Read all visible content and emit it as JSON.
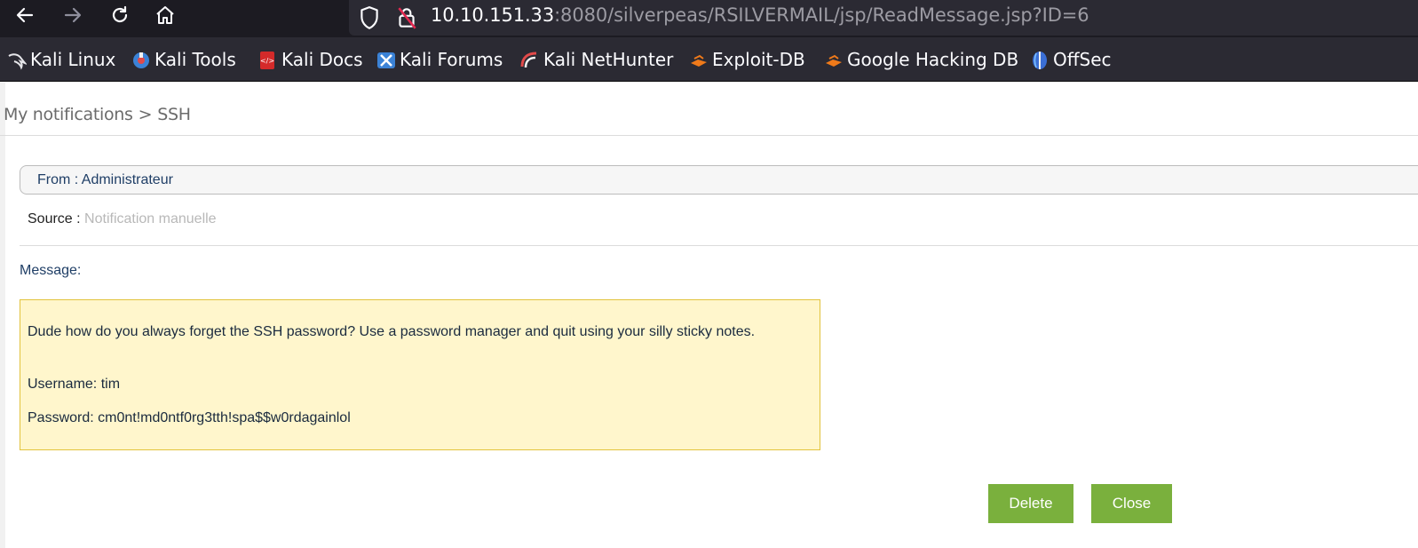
{
  "browser": {
    "url_host": "10.10.151.33",
    "url_rest": ":8080/silverpeas/RSILVERMAIL/jsp/ReadMessage.jsp?ID=6",
    "bookmarks": [
      {
        "label": "Kali Linux",
        "icon": "kali-dragon-icon"
      },
      {
        "label": "Kali Tools",
        "icon": "kali-tools-icon"
      },
      {
        "label": "Kali Docs",
        "icon": "kali-docs-icon"
      },
      {
        "label": "Kali Forums",
        "icon": "kali-forums-icon"
      },
      {
        "label": "Kali NetHunter",
        "icon": "kali-nethunter-icon"
      },
      {
        "label": "Exploit-DB",
        "icon": "exploit-db-icon"
      },
      {
        "label": "Google Hacking DB",
        "icon": "google-hacking-db-icon"
      },
      {
        "label": "OffSec",
        "icon": "offsec-icon"
      }
    ]
  },
  "breadcrumb": {
    "parent": "My notifications",
    "separator": ">",
    "current": "SSH"
  },
  "message": {
    "from": "From : Administrateur",
    "source_label": "Source :",
    "source_value": "Notification manuelle",
    "label": "Message:",
    "body": [
      "Dude how do you always forget the SSH password? Use a password manager and quit using your silly sticky notes.",
      "Username: tim",
      "Password: cm0nt!md0ntf0rg3tth!spa$$w0rdagainlol"
    ]
  },
  "actions": {
    "delete": "Delete",
    "close": "Close"
  },
  "colors": {
    "toolbar_bg": "#1c1b22",
    "urlbar_bg": "#2b2a33",
    "message_bg": "#fff6cc",
    "message_border": "#e2c33c",
    "button_green": "#7ab03d",
    "label_blue": "#1f3e66"
  }
}
